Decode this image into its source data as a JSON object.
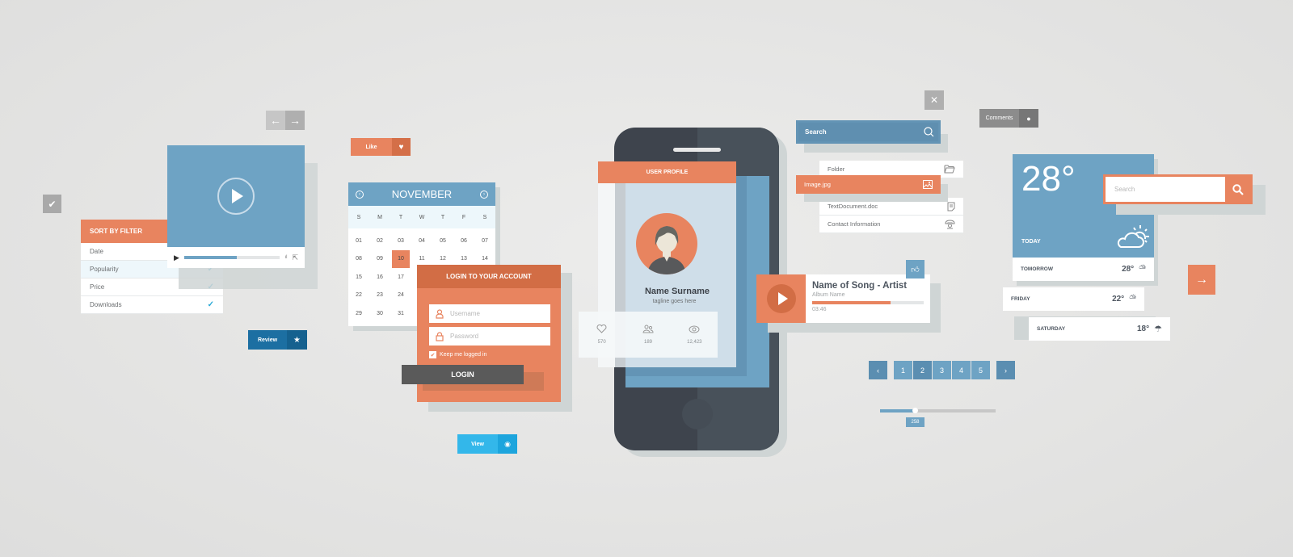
{
  "colors": {
    "accent_orange": "#e8845f",
    "accent_blue": "#6ea3c4",
    "dark_phone": "#3e444d",
    "review_blue": "#1c6fa2",
    "view_cyan": "#33b7ea"
  },
  "nav_arrows": {
    "prev_icon": "arrow-left-icon",
    "next_icon": "arrow-right-icon"
  },
  "check_button": {
    "icon": "check-icon"
  },
  "sort_filter": {
    "title": "SORT BY FILTER",
    "items": [
      {
        "label": "Date",
        "checked": false,
        "selected": false
      },
      {
        "label": "Popularity",
        "checked": true,
        "selected": true
      },
      {
        "label": "Price",
        "checked": true,
        "selected": false
      },
      {
        "label": "Downloads",
        "checked": true,
        "selected": false
      }
    ]
  },
  "video_player": {
    "progress": 0.55
  },
  "like_button": {
    "label": "Like",
    "icon": "heart-icon"
  },
  "calendar": {
    "month": "NOVEMBER",
    "weekdays": [
      "S",
      "M",
      "T",
      "W",
      "T",
      "F",
      "S"
    ],
    "dates": [
      "01",
      "02",
      "03",
      "04",
      "05",
      "06",
      "07",
      "08",
      "09",
      "10",
      "11",
      "12",
      "13",
      "14",
      "15",
      "16",
      "17",
      "",
      "",
      "",
      "",
      "22",
      "23",
      "24",
      "",
      "",
      "",
      "",
      "29",
      "30",
      "31",
      "",
      "",
      "",
      ""
    ],
    "selected": "10"
  },
  "login": {
    "title": "LOGIN TO YOUR ACCOUNT",
    "username_placeholder": "Username",
    "password_placeholder": "Password",
    "keep_logged_in": "Keep me logged in",
    "keep_checked": true,
    "button": "LOGIN"
  },
  "review_button": {
    "label": "Review",
    "icon": "star-icon"
  },
  "view_button": {
    "label": "View",
    "icon": "eye-icon"
  },
  "profile": {
    "header": "USER PROFILE",
    "name": "Name Surname",
    "tagline": "tagline goes here",
    "stats": [
      {
        "icon": "heart-icon",
        "value": "570"
      },
      {
        "icon": "users-icon",
        "value": "189"
      },
      {
        "icon": "eye-icon",
        "value": "12,423"
      }
    ]
  },
  "file_panel": {
    "search_label": "Search",
    "items": [
      {
        "label": "Folder",
        "icon": "folder-icon"
      },
      {
        "label": "Image.jpg",
        "icon": "image-icon",
        "highlighted": true
      },
      {
        "label": "TextDocument.doc",
        "icon": "document-icon"
      },
      {
        "label": "Contact Information",
        "icon": "phone-icon"
      }
    ]
  },
  "music": {
    "title": "Name of Song - Artist",
    "album": "Album Name",
    "time": "03:46",
    "progress": 0.7
  },
  "comments_button": {
    "label": "Comments",
    "icon": "speech-bubble-icon"
  },
  "weather": {
    "today_temp": "28°",
    "today_label": "TODAY",
    "forecast": [
      {
        "day": "TOMORROW",
        "temp": "28°",
        "icon": "cloud-sun-icon"
      },
      {
        "day": "FRIDAY",
        "temp": "22°",
        "icon": "cloud-sun-rain-icon"
      },
      {
        "day": "SATURDAY",
        "temp": "18°",
        "icon": "cloud-rain-icon"
      }
    ]
  },
  "search_orange": {
    "placeholder": "Search"
  },
  "pagination": {
    "pages": [
      "1",
      "2",
      "3",
      "4",
      "5"
    ],
    "current": "2"
  },
  "slider": {
    "value": "258",
    "fraction": 0.3
  }
}
